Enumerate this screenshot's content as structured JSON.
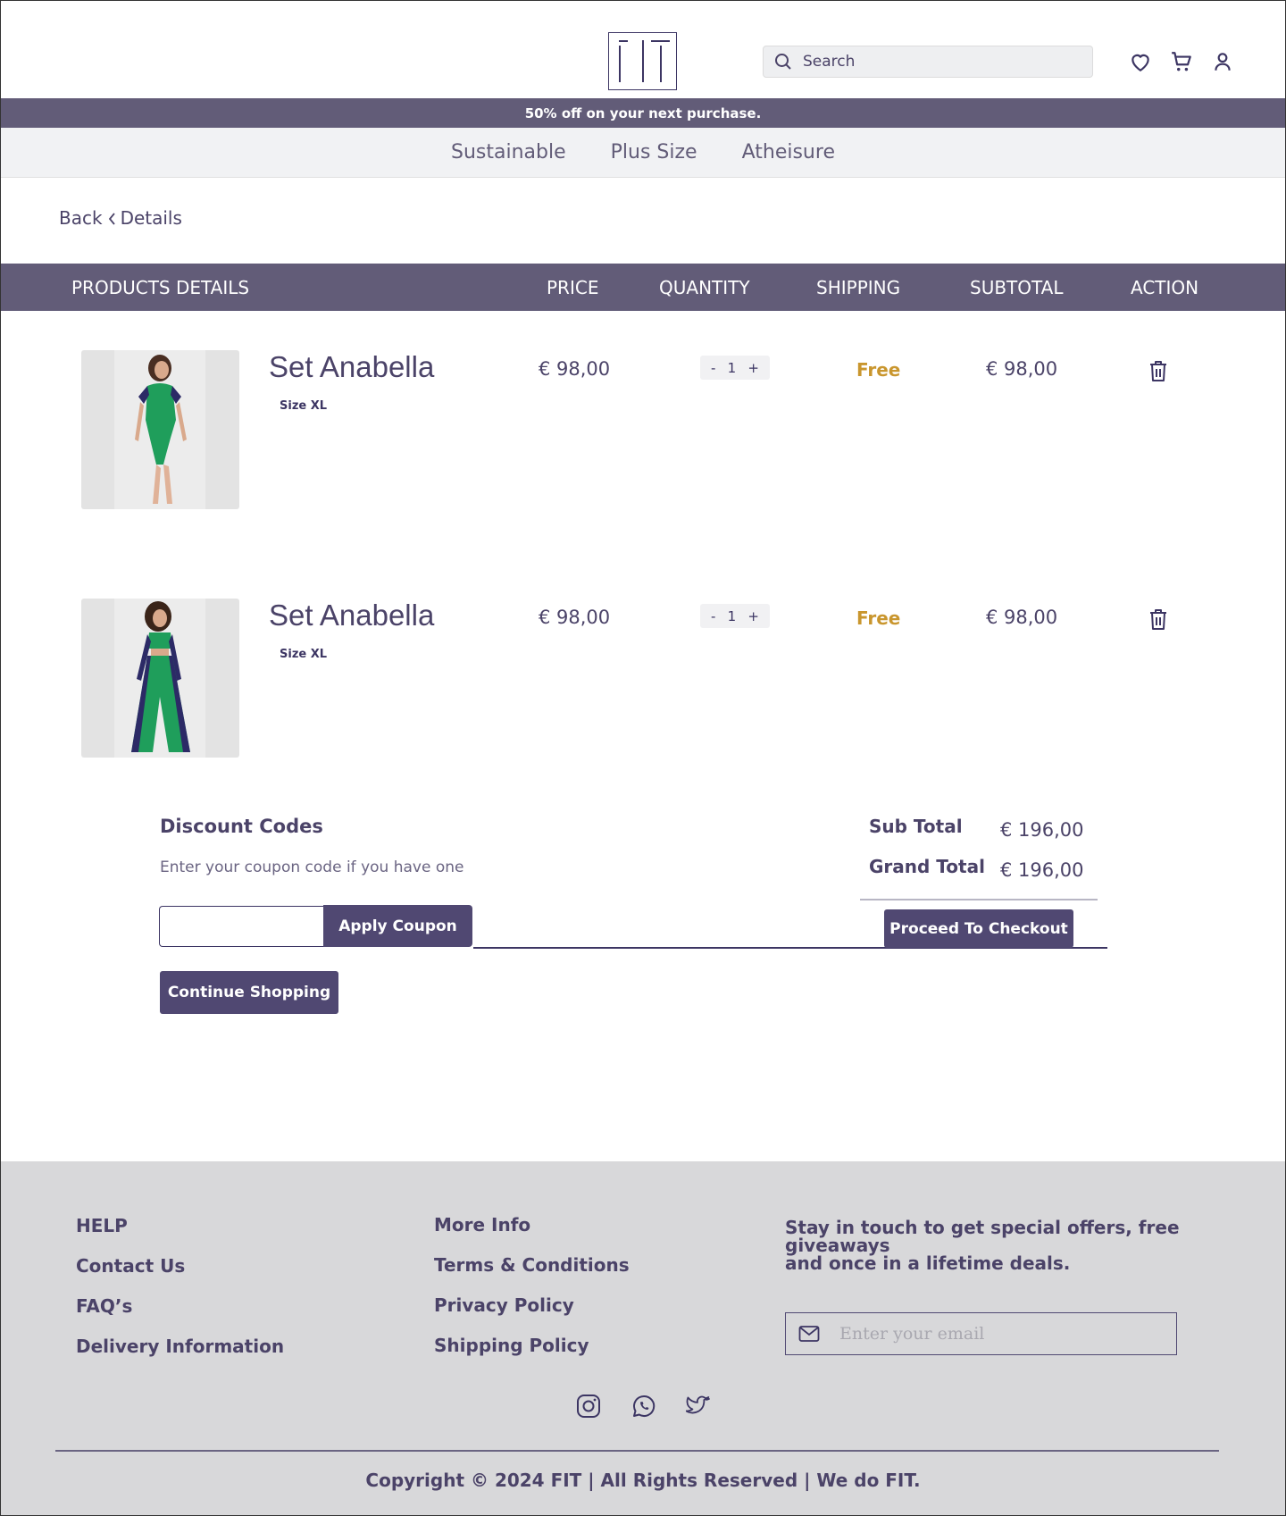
{
  "header": {
    "logo_text": "FIT",
    "search_placeholder": "Search"
  },
  "promo": {
    "text": "50% off on your next purchase."
  },
  "categories": [
    "Sustainable",
    "Plus Size",
    "Atheisure"
  ],
  "breadcrumb": {
    "back": "Back",
    "current": "Details"
  },
  "table_header": {
    "products": "PRODUCTS DETAILS",
    "price": "PRICE",
    "quantity": "QUANTITY",
    "shipping": "SHIPPING",
    "subtotal": "SUBTOTAL",
    "action": "ACTION"
  },
  "cart_items": [
    {
      "name": "Set Anabella",
      "size": "Size XL",
      "price": "€ 98,00",
      "qty_minus": "-",
      "qty": "1",
      "qty_plus": "+",
      "shipping": "Free",
      "subtotal": "€ 98,00",
      "image": "green-navy-bodysuit"
    },
    {
      "name": "Set Anabella",
      "size": "Size XL",
      "price": "€ 98,00",
      "qty_minus": "-",
      "qty": "1",
      "qty_plus": "+",
      "shipping": "Free",
      "subtotal": "€ 98,00",
      "image": "green-navy-crop-top-wide-pants"
    }
  ],
  "discount": {
    "title": "Discount Codes",
    "description": "Enter your coupon code if you have one",
    "input_value": "",
    "apply_label": "Apply Coupon",
    "continue_label": "Continue Shopping"
  },
  "totals": {
    "sub_total_label": "Sub Total",
    "sub_total_value": "€ 196,00",
    "grand_total_label": "Grand Total",
    "grand_total_value": "€ 196,00",
    "checkout_label": "Proceed To Checkout"
  },
  "footer": {
    "help_col": [
      "HELP",
      "Contact Us",
      "FAQ’s",
      "Delivery Information"
    ],
    "info_col": [
      "More Info",
      "Terms & Conditions",
      "Privacy Policy",
      "Shipping Policy"
    ],
    "newsletter_line1": "Stay in touch to get special offers, free giveaways",
    "newsletter_line2": "and once in a lifetime deals.",
    "email_placeholder": "Enter your email",
    "copyright": "Copyright © 2024 FIT | All Rights Reserved |  We do FIT.",
    "social_icons": [
      "instagram-icon",
      "whatsapp-icon",
      "twitter-icon"
    ]
  },
  "colors": {
    "brand": "#625c78",
    "button": "#504872",
    "text": "#4b4368",
    "free": "#c9962e",
    "footer_bg": "#d8d8da"
  }
}
